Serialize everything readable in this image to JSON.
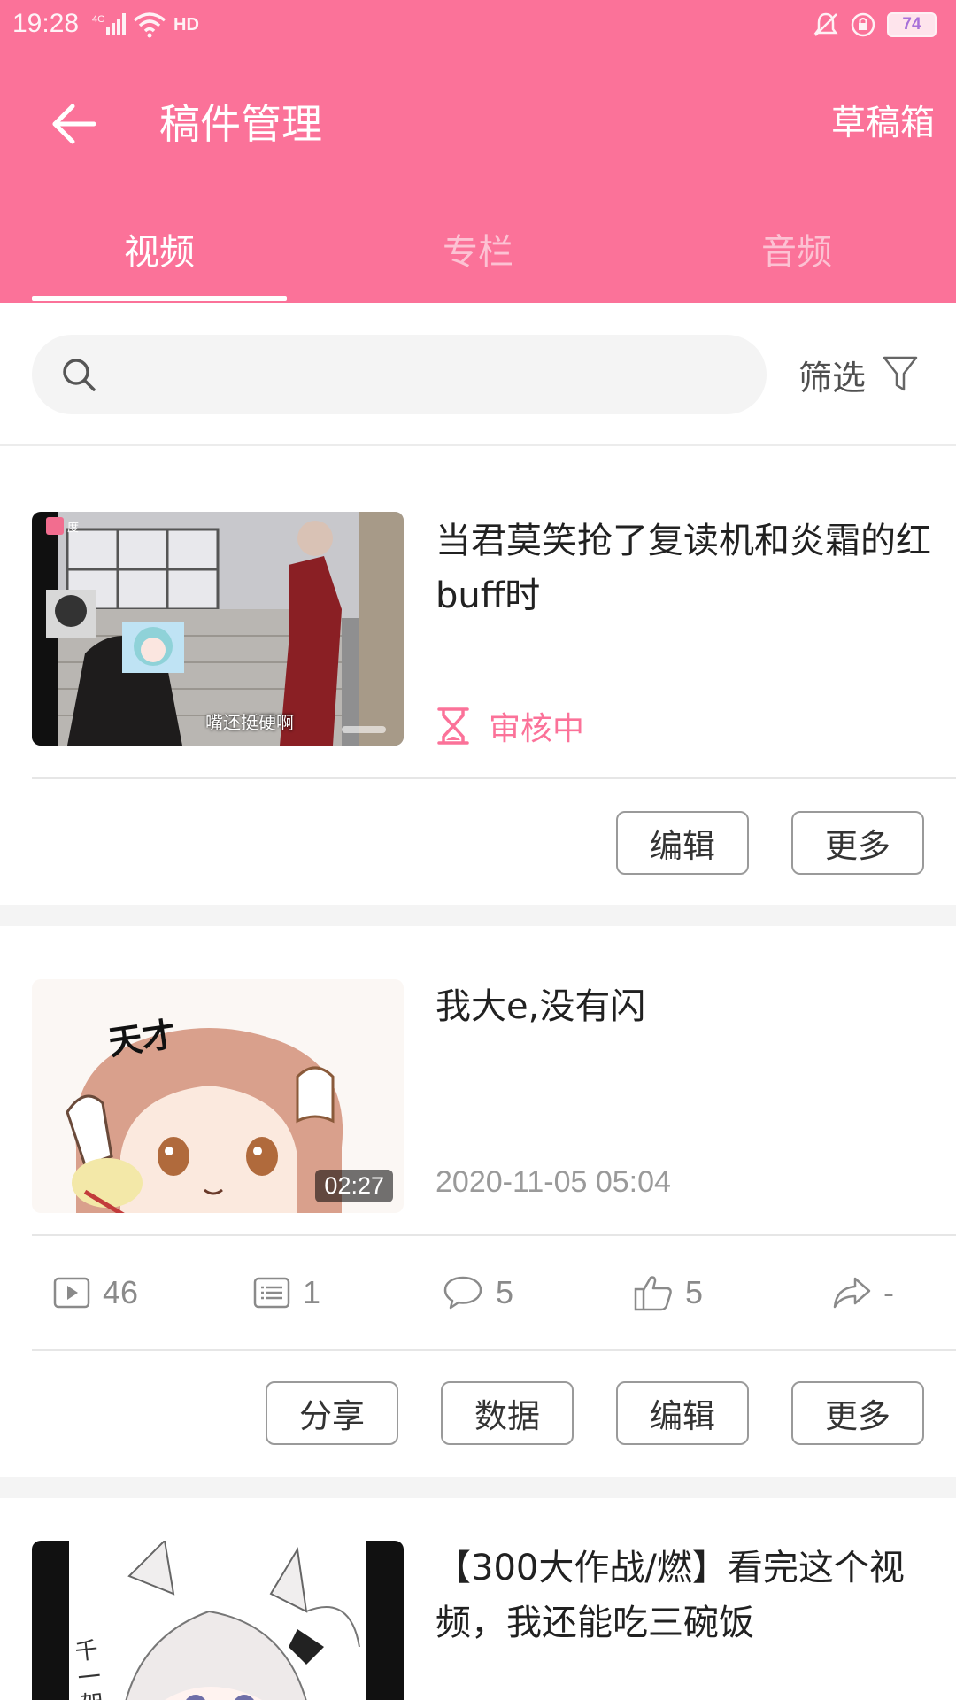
{
  "status_bar": {
    "time": "19:28",
    "network": "4G",
    "hd": "HD",
    "battery": "74"
  },
  "header": {
    "title": "稿件管理",
    "drafts": "草稿箱",
    "tabs": [
      {
        "label": "视频",
        "active": true
      },
      {
        "label": "专栏",
        "active": false
      },
      {
        "label": "音频",
        "active": false
      }
    ]
  },
  "search": {
    "placeholder": "",
    "filter_label": "筛选"
  },
  "videos": [
    {
      "title": "当君莫笑抢了复读机和炎霜的红buff时",
      "status": "审核中",
      "thumbnail_caption": "嘴还挺硬啊",
      "actions": [
        "编辑",
        "更多"
      ]
    },
    {
      "title": "我大e,没有闪",
      "date": "2020-11-05 05:04",
      "duration": "02:27",
      "thumbnail_caption": "天才",
      "stats": {
        "plays": "46",
        "danmaku": "1",
        "comments": "5",
        "likes": "5",
        "shares": "-"
      },
      "actions": [
        "分享",
        "数据",
        "编辑",
        "更多"
      ]
    },
    {
      "title": "【300大作战/燃】看完这个视频，我还能吃三碗饭",
      "thumbnail_caption": "千一架"
    }
  ],
  "colors": {
    "accent": "#fb7299",
    "tab_inactive": "#fcc2d3",
    "muted_text": "#9a9a9a",
    "divider": "#e6e6e6"
  }
}
